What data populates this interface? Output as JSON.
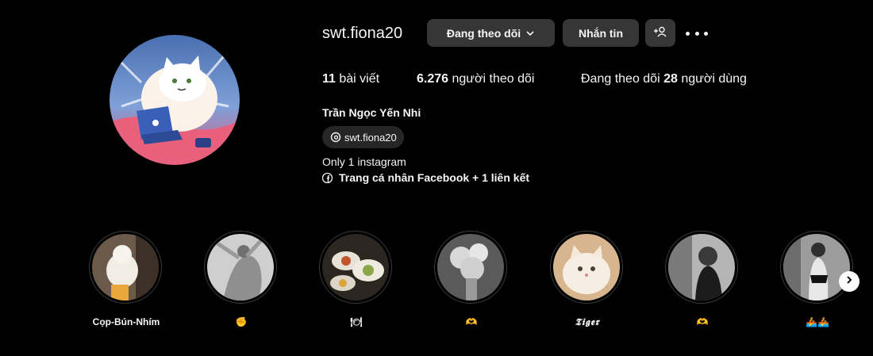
{
  "profile": {
    "username": "swt.fiona20",
    "full_name": "Trần Ngọc Yến Nhi",
    "threads_handle": "swt.fiona20",
    "bio": "Only 1 instagram",
    "link_text": "Trang cá nhân Facebook + 1 liên kết"
  },
  "actions": {
    "following_label": "Đang theo dõi",
    "message_label": "Nhắn tin",
    "add_icon": "person-add-icon",
    "more_icon": "more-options-icon"
  },
  "stats": {
    "posts_count": "11",
    "posts_label": " bài viết",
    "followers_count": "6.276",
    "followers_label": " người theo dõi",
    "following_prefix": "Đang theo dõi ",
    "following_count": "28",
    "following_suffix": " người dùng"
  },
  "highlights": [
    {
      "label": "Cọp-Bún-Nhím"
    },
    {
      "label": "✊"
    },
    {
      "label": "🍽"
    },
    {
      "label": "🫶"
    },
    {
      "label": "𝕿𝖎𝖌𝖊𝖗"
    },
    {
      "label": "🫶"
    },
    {
      "label": "🚣🚣"
    }
  ],
  "colors": {
    "background": "#000000",
    "button_bg": "#363636",
    "pill_bg": "#262626",
    "text": "#f5f5f5"
  }
}
